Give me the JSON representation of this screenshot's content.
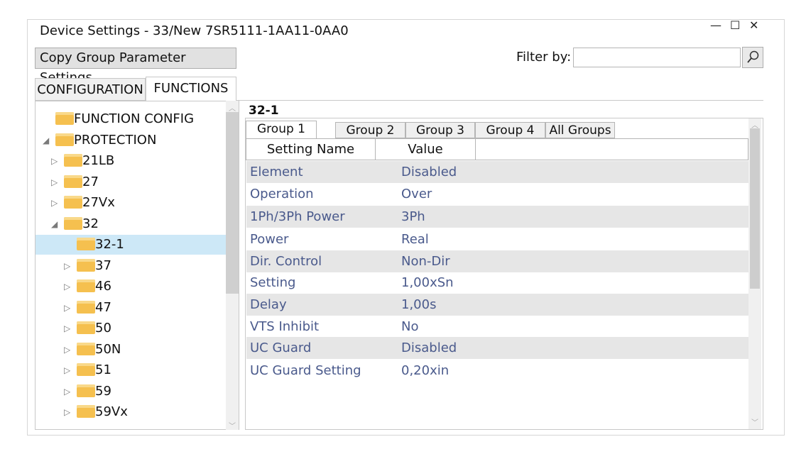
{
  "window": {
    "title": "Device Settings - 33/New 7SR5111-1AA11-0AA0",
    "min_icon": "—",
    "max_icon": "☐",
    "close_icon": "✕"
  },
  "toolbar": {
    "copy_button": "Copy Group Parameter Settings",
    "filter_label": "Filter by:",
    "filter_value": "",
    "search_icon": "search-icon"
  },
  "main_tabs": [
    "CONFIGURATION",
    "FUNCTIONS"
  ],
  "tree": {
    "items": [
      {
        "label": "FUNCTION CONFIG",
        "level": 0,
        "expander": ""
      },
      {
        "label": "PROTECTION",
        "level": 0,
        "expander": "◢"
      },
      {
        "label": "21LB",
        "level": 1,
        "expander": "▷"
      },
      {
        "label": "27",
        "level": 1,
        "expander": "▷"
      },
      {
        "label": "27Vx",
        "level": 1,
        "expander": "▷"
      },
      {
        "label": "32",
        "level": 1,
        "expander": "◢"
      },
      {
        "label": "32-1",
        "level": 2,
        "expander": ""
      },
      {
        "label": "37",
        "level": 2,
        "expander": "▷"
      },
      {
        "label": "46",
        "level": 2,
        "expander": "▷"
      },
      {
        "label": "47",
        "level": 2,
        "expander": "▷"
      },
      {
        "label": "50",
        "level": 2,
        "expander": "▷"
      },
      {
        "label": "50N",
        "level": 2,
        "expander": "▷"
      },
      {
        "label": "51",
        "level": 2,
        "expander": "▷"
      },
      {
        "label": "59",
        "level": 2,
        "expander": "▷"
      },
      {
        "label": "59Vx",
        "level": 2,
        "expander": "▷"
      }
    ]
  },
  "group_panel": {
    "title": "32-1",
    "tabs": [
      "Group 1",
      "Group 2",
      "Group 3",
      "Group 4",
      "All Groups"
    ],
    "columns": [
      "Setting Name",
      "Value"
    ],
    "rows": [
      {
        "name": "Element",
        "value": "Disabled"
      },
      {
        "name": "Operation",
        "value": "Over"
      },
      {
        "name": "1Ph/3Ph Power",
        "value": "3Ph"
      },
      {
        "name": "Power",
        "value": "Real"
      },
      {
        "name": "Dir. Control",
        "value": "Non-Dir"
      },
      {
        "name": "Setting",
        "value": "1,00xSn"
      },
      {
        "name": "Delay",
        "value": "1,00s"
      },
      {
        "name": "VTS Inhibit",
        "value": "No"
      },
      {
        "name": "UC Guard",
        "value": "Disabled"
      },
      {
        "name": "UC Guard Setting",
        "value": "0,20xin"
      }
    ]
  }
}
